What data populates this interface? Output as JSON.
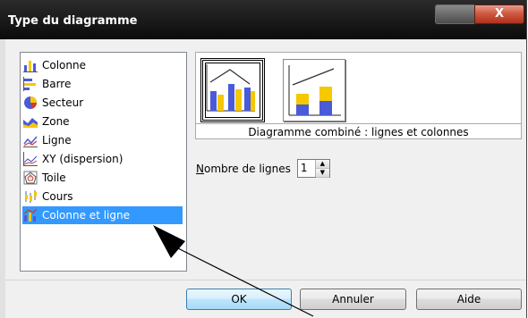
{
  "window": {
    "title": "Type du diagramme",
    "close_glyph": "X"
  },
  "chart_types": [
    {
      "label": "Colonne",
      "icon": "column-chart-icon"
    },
    {
      "label": "Barre",
      "icon": "bar-chart-icon"
    },
    {
      "label": "Secteur",
      "icon": "pie-chart-icon"
    },
    {
      "label": "Zone",
      "icon": "area-chart-icon"
    },
    {
      "label": "Ligne",
      "icon": "line-chart-icon"
    },
    {
      "label": "XY (dispersion)",
      "icon": "xy-scatter-chart-icon"
    },
    {
      "label": "Toile",
      "icon": "net-chart-icon"
    },
    {
      "label": "Cours",
      "icon": "stock-chart-icon"
    },
    {
      "label": "Colonne et ligne",
      "icon": "column-line-chart-icon",
      "selected": true
    }
  ],
  "preview": {
    "caption": "Diagramme combiné : lignes et colonnes",
    "variants": [
      "columns-and-lines-thumbnail",
      "stacked-columns-and-lines-thumbnail"
    ],
    "selected_variant": 0
  },
  "lines": {
    "label": "Nombre de lignes",
    "value": "1"
  },
  "buttons": {
    "ok": "OK",
    "cancel": "Annuler",
    "help": "Aide"
  },
  "colors": {
    "selection": "#3399ff",
    "bar_blue": "#4a5bd8",
    "bar_yellow": "#f5c800"
  }
}
